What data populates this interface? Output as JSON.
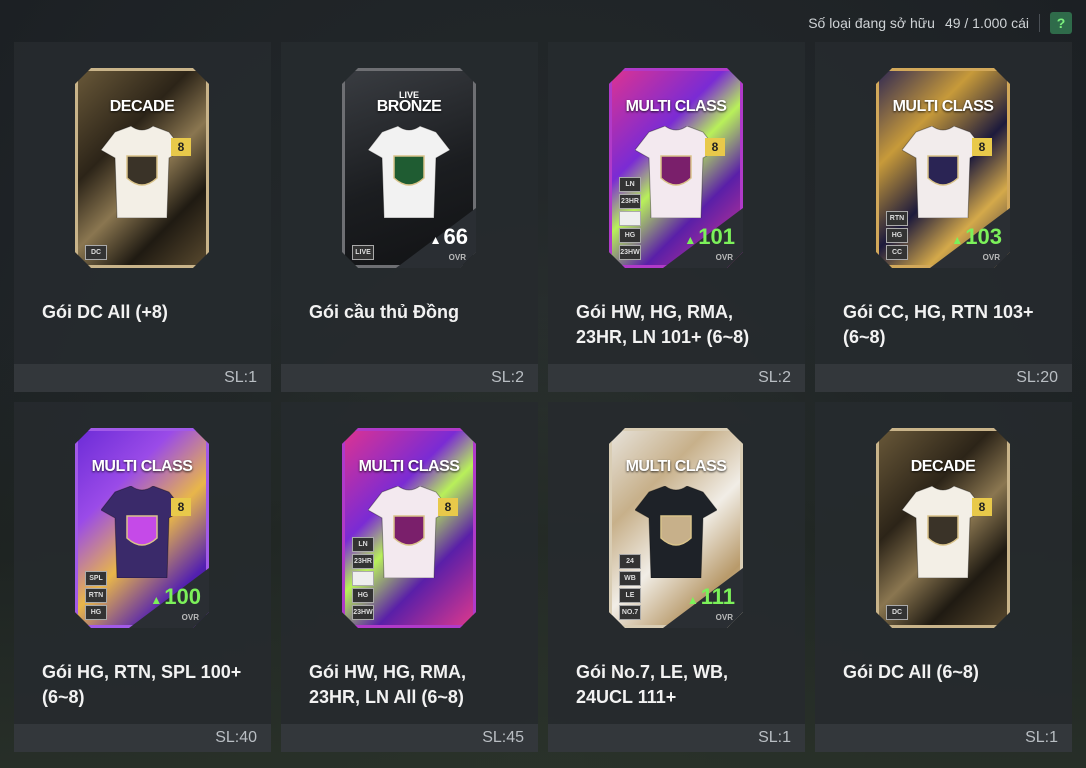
{
  "header": {
    "owned_label": "Số loại đang sở hữu",
    "owned_value": "49 / 1.000 cái",
    "help_label": "?"
  },
  "packs": [
    {
      "name": "Gói DC All (+8)",
      "qty": "SL:1",
      "card_title": "DECADE",
      "card_sub": "",
      "level": "8",
      "tags": [
        "DC"
      ],
      "ovr": "",
      "ovr_label": "",
      "theme": "decade"
    },
    {
      "name": "Gói cầu thủ Đồng",
      "qty": "SL:2",
      "card_title": "BRONZE",
      "card_sub": "LIVE",
      "level": "",
      "tags": [
        "LIVE"
      ],
      "ovr": "66",
      "ovr_label": "OVR",
      "theme": "bronze"
    },
    {
      "name": "Gói HW, HG, RMA, 23HR, LN 101+ (6~8)",
      "qty": "SL:2",
      "card_title": "MULTI CLASS",
      "card_sub": "",
      "level": "8",
      "tags": [
        "LN",
        "23HR",
        "",
        "HG",
        "23HW"
      ],
      "ovr": "101",
      "ovr_label": "OVR",
      "theme": "multi-pink"
    },
    {
      "name": "Gói CC, HG, RTN 103+ (6~8)",
      "qty": "SL:20",
      "card_title": "MULTI CLASS",
      "card_sub": "",
      "level": "8",
      "tags": [
        "RTN",
        "HG",
        "CC"
      ],
      "ovr": "103",
      "ovr_label": "OVR",
      "theme": "multi-navy"
    },
    {
      "name": "Gói HG, RTN, SPL 100+ (6~8)",
      "qty": "SL:40",
      "card_title": "MULTI CLASS",
      "card_sub": "",
      "level": "8",
      "tags": [
        "SPL",
        "RTN",
        "HG"
      ],
      "ovr": "100",
      "ovr_label": "OVR",
      "theme": "multi-purple"
    },
    {
      "name": "Gói HW, HG, RMA, 23HR, LN All (6~8)",
      "qty": "SL:45",
      "card_title": "MULTI CLASS",
      "card_sub": "",
      "level": "8",
      "tags": [
        "LN",
        "23HR",
        "",
        "HG",
        "23HW"
      ],
      "ovr": "",
      "ovr_label": "",
      "theme": "multi-pink"
    },
    {
      "name": "Gói No.7, LE, WB, 24UCL 111+",
      "qty": "SL:1",
      "card_title": "MULTI CLASS",
      "card_sub": "",
      "level": "",
      "tags": [
        "24",
        "WB",
        "LE",
        "NO.7"
      ],
      "ovr": "111",
      "ovr_label": "OVR",
      "theme": "multi-silver"
    },
    {
      "name": "Gói DC All (6~8)",
      "qty": "SL:1",
      "card_title": "DECADE",
      "card_sub": "",
      "level": "8",
      "tags": [
        "DC"
      ],
      "ovr": "",
      "ovr_label": "",
      "theme": "decade"
    }
  ],
  "colors": {
    "accent_green": "#7cf15a",
    "level_gold": "#e8c94a",
    "tile_bg": "#262a2e"
  }
}
